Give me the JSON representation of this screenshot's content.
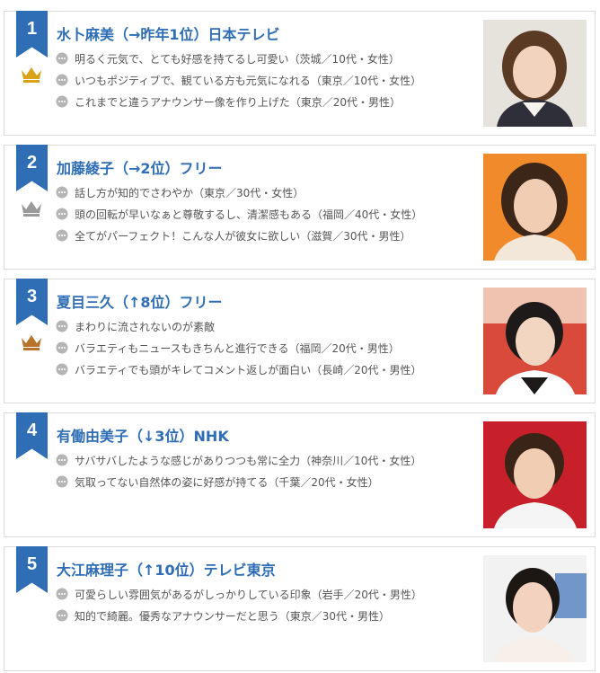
{
  "colors": {
    "accent": "#2f6db5",
    "gold": "#d9a21b",
    "silver": "#9a9a9a",
    "bronze": "#b8732a"
  },
  "entries": [
    {
      "rank": "1",
      "title": "水卜麻美（→昨年1位）日本テレビ",
      "crown": "gold-crown-icon",
      "comments": [
        "明るく元気で、とても好感を持てるし可愛い（茨城／10代・女性）",
        "いつもポジティブで、観ている方も元気になれる（東京／10代・女性）",
        "これまでと違うアナウンサー像を作り上げた（東京／20代・男性）"
      ]
    },
    {
      "rank": "2",
      "title": "加藤綾子（→2位）フリー",
      "crown": "silver-crown-icon",
      "comments": [
        "話し方が知的でさわやか（東京／30代・女性）",
        "頭の回転が早いなぁと尊敬するし、清潔感もある（福岡／40代・女性）",
        "全てがパーフェクト！こんな人が彼女に欲しい（滋賀／30代・男性）"
      ]
    },
    {
      "rank": "3",
      "title": "夏目三久（↑8位）フリー",
      "crown": "bronze-crown-icon",
      "comments": [
        "まわりに流されないのが素敵",
        "バラエティもニュースもきちんと進行できる（福岡／20代・男性）",
        "バラエティでも頭がキレてコメント返しが面白い（長崎／20代・男性）"
      ]
    },
    {
      "rank": "4",
      "title": "有働由美子（↓3位）NHK",
      "crown": "",
      "comments": [
        "サバサバしたような感じがありつつも常に全力（神奈川／10代・女性）",
        "気取ってない自然体の姿に好感が持てる（千葉／20代・女性）"
      ]
    },
    {
      "rank": "5",
      "title": "大江麻理子（↑10位）テレビ東京",
      "crown": "",
      "comments": [
        "可愛らしい雰囲気があるがしっかりしている印象（岩手／20代・男性）",
        "知的で綺麗。優秀なアナウンサーだと思う（東京／30代・男性）"
      ]
    }
  ]
}
